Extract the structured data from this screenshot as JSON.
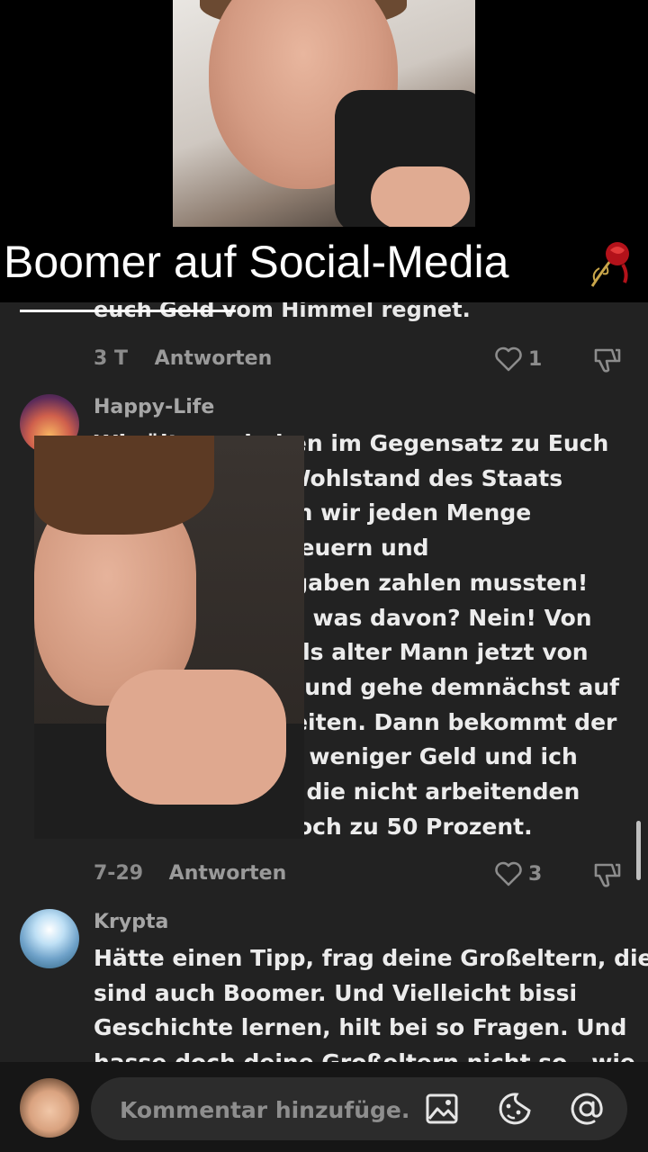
{
  "banner": {
    "title": "Boomer auf Social-Media"
  },
  "comments": {
    "cut_off_text": "euch Geld vom Himmel regnet.",
    "first": {
      "time": "3 T",
      "reply": "Antworten",
      "likes": "1"
    },
    "second": {
      "author": "Happy-Life",
      "lines": [
        "Wir älteren haben im Gegensatz zu Euch",
        "n den Wohlstand des Staats",
        "t, indem wir jeden Menge",
        "menssteuern und",
        "ssozialabgaben zahlen mussten!",
        "wir Ältere was davon? Nein! Von",
        "lerne ich als alter Mann jetzt von",
        "eren, und gehe demnächst auf",
        "arbeiten. Dann bekommt der",
        "ent weniger Geld und ich",
        "h die nicht arbeitenden",
        "och zu 50 Prozent."
      ],
      "time": "7-29",
      "reply": "Antworten",
      "likes": "3"
    },
    "third": {
      "author": "Krypta",
      "lines": [
        "Hätte einen Tipp, frag deine Großeltern, die",
        "sind auch Boomer. Und Vielleicht bissi",
        "Geschichte lernen, hilt bei so Fragen. Und",
        "hasse doch deine Großeltern nicht so , wie"
      ]
    }
  },
  "composer": {
    "placeholder": "Kommentar hinzufüge..."
  },
  "icons": [
    "rose-icon",
    "heart-icon",
    "dislike-icon",
    "image-icon",
    "emoji-icon",
    "mention-icon"
  ],
  "colors": {
    "panel": "#222222",
    "text": "#ececec",
    "muted": "#8c8c8c"
  }
}
